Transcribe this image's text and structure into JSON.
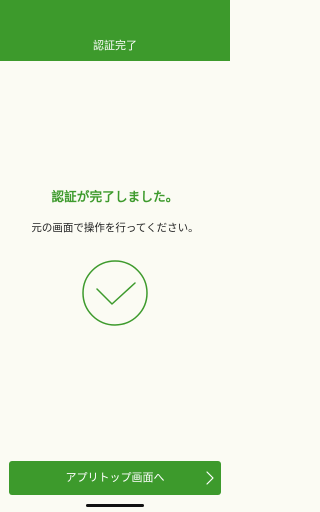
{
  "header": {
    "title": "認証完了"
  },
  "main": {
    "title": "認証が完了しました。",
    "message": "元の画面で操作を行ってください。",
    "status_icon": "check-circle-icon"
  },
  "footer": {
    "button_label": "アプリトップ画面へ",
    "button_icon": "chevron-right-icon"
  },
  "colors": {
    "accent": "#3d9a2c",
    "background": "#fbfbf3",
    "text": "#222222"
  }
}
